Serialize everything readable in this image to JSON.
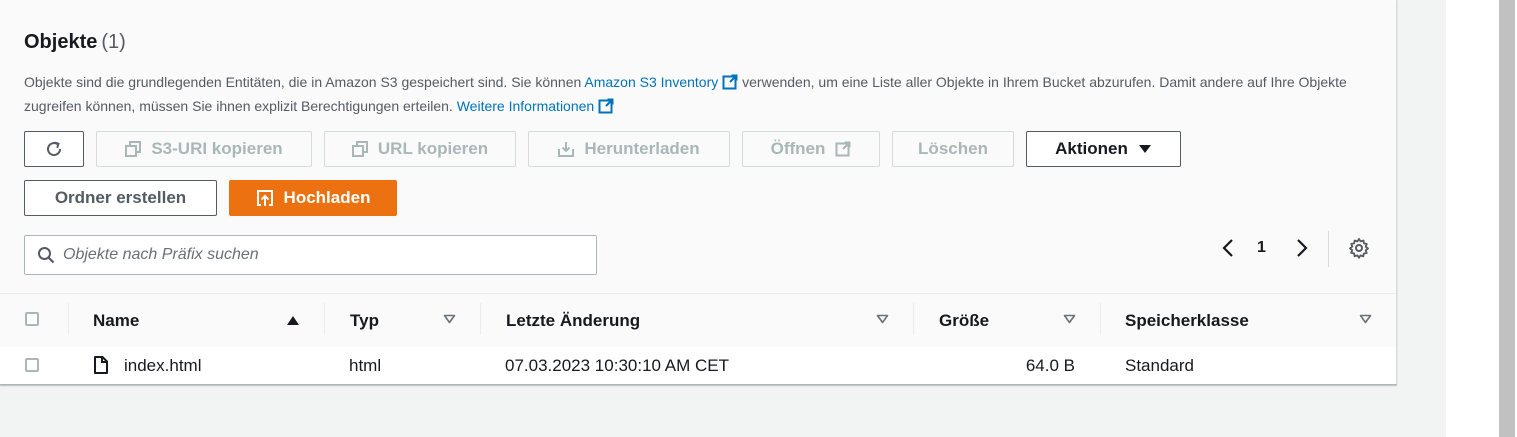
{
  "header": {
    "title": "Objekte",
    "count": "(1)"
  },
  "description": {
    "part1": "Objekte sind die grundlegenden Entitäten, die in Amazon S3 gespeichert sind. Sie können ",
    "link1": "Amazon S3 Inventory",
    "part2": " verwenden, um eine Liste aller Objekte in Ihrem Bucket abzurufen. Damit andere auf Ihre Objekte zugreifen können, müssen Sie ihnen explizit Berechtigungen erteilen. ",
    "link2": "Weitere Informationen"
  },
  "toolbar": {
    "copy_s3_uri": "S3-URI kopieren",
    "copy_url": "URL kopieren",
    "download": "Herunterladen",
    "open": "Öffnen",
    "delete": "Löschen",
    "actions": "Aktionen",
    "create_folder": "Ordner erstellen",
    "upload": "Hochladen"
  },
  "search": {
    "placeholder": "Objekte nach Präfix suchen"
  },
  "pagination": {
    "current_page": "1"
  },
  "table": {
    "columns": {
      "name": "Name",
      "type": "Typ",
      "last_modified": "Letzte Änderung",
      "size": "Größe",
      "storage_class": "Speicherklasse"
    },
    "rows": [
      {
        "name": "index.html",
        "type": "html",
        "last_modified": "07.03.2023 10:30:10 AM CET",
        "size": "64.0 B",
        "storage_class": "Standard"
      }
    ]
  },
  "colors": {
    "link": "#0073bb",
    "primary": "#ec7211",
    "disabled": "#aab7b8",
    "text": "#16191f"
  },
  "icons": [
    "refresh-icon",
    "copy-icon",
    "download-icon",
    "external-link-icon",
    "caret-down-icon",
    "upload-icon",
    "search-icon",
    "chevron-left-icon",
    "chevron-right-icon",
    "gear-icon",
    "sort-ascending-icon",
    "sort-icon",
    "file-icon"
  ]
}
